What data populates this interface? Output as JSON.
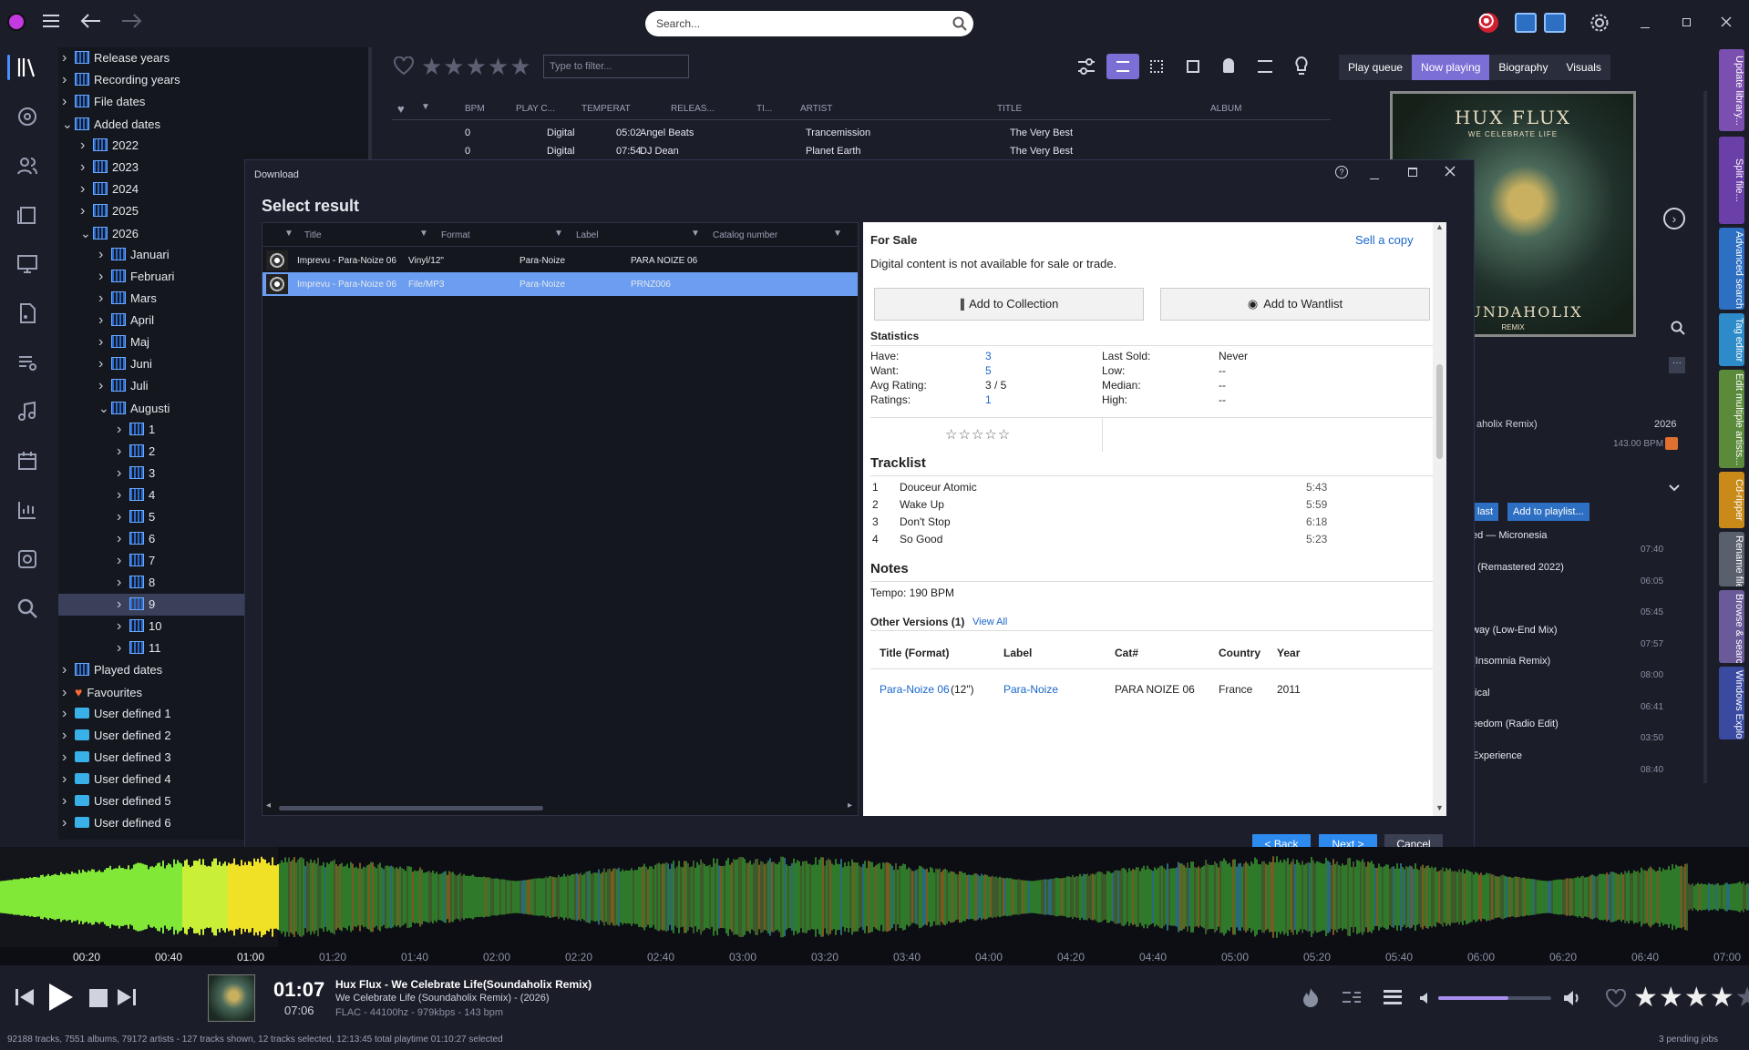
{
  "app": {
    "search_placeholder": "Search..."
  },
  "tree": {
    "items": [
      {
        "label": "Release years",
        "level": 0,
        "icon": "calendar",
        "open": false
      },
      {
        "label": "Recording years",
        "level": 0,
        "icon": "calendar",
        "open": false
      },
      {
        "label": "File dates",
        "level": 0,
        "icon": "calendar",
        "open": false
      },
      {
        "label": "Added dates",
        "level": 0,
        "icon": "calendar",
        "open": true
      },
      {
        "label": "2022",
        "level": 1,
        "icon": "calendar",
        "open": false
      },
      {
        "label": "2023",
        "level": 1,
        "icon": "calendar",
        "open": false
      },
      {
        "label": "2024",
        "level": 1,
        "icon": "calendar",
        "open": false
      },
      {
        "label": "2025",
        "level": 1,
        "icon": "calendar",
        "open": false
      },
      {
        "label": "2026",
        "level": 1,
        "icon": "calendar",
        "open": true
      },
      {
        "label": "Januari",
        "level": 2,
        "icon": "calendar",
        "open": false
      },
      {
        "label": "Februari",
        "level": 2,
        "icon": "calendar",
        "open": false
      },
      {
        "label": "Mars",
        "level": 2,
        "icon": "calendar",
        "open": false
      },
      {
        "label": "April",
        "level": 2,
        "icon": "calendar",
        "open": false
      },
      {
        "label": "Maj",
        "level": 2,
        "icon": "calendar",
        "open": false
      },
      {
        "label": "Juni",
        "level": 2,
        "icon": "calendar",
        "open": false
      },
      {
        "label": "Juli",
        "level": 2,
        "icon": "calendar",
        "open": false
      },
      {
        "label": "Augusti",
        "level": 2,
        "icon": "calendar",
        "open": true
      },
      {
        "label": "1",
        "level": 3,
        "icon": "calendar",
        "open": false
      },
      {
        "label": "2",
        "level": 3,
        "icon": "calendar",
        "open": false
      },
      {
        "label": "3",
        "level": 3,
        "icon": "calendar",
        "open": false
      },
      {
        "label": "4",
        "level": 3,
        "icon": "calendar",
        "open": false
      },
      {
        "label": "5",
        "level": 3,
        "icon": "calendar",
        "open": false
      },
      {
        "label": "6",
        "level": 3,
        "icon": "calendar",
        "open": false
      },
      {
        "label": "7",
        "level": 3,
        "icon": "calendar",
        "open": false
      },
      {
        "label": "8",
        "level": 3,
        "icon": "calendar",
        "open": false
      },
      {
        "label": "9",
        "level": 3,
        "icon": "calendar",
        "open": false,
        "selected": true
      },
      {
        "label": "10",
        "level": 3,
        "icon": "calendar",
        "open": false
      },
      {
        "label": "11",
        "level": 3,
        "icon": "calendar",
        "open": false
      },
      {
        "label": "Played dates",
        "level": 0,
        "icon": "calendar",
        "open": false
      },
      {
        "label": "Favourites",
        "level": 0,
        "icon": "heart",
        "open": false
      },
      {
        "label": "User defined 1",
        "level": 0,
        "icon": "folder",
        "open": false
      },
      {
        "label": "User defined 2",
        "level": 0,
        "icon": "folder",
        "open": false
      },
      {
        "label": "User defined 3",
        "level": 0,
        "icon": "folder",
        "open": false
      },
      {
        "label": "User defined 4",
        "level": 0,
        "icon": "folder",
        "open": false
      },
      {
        "label": "User defined 5",
        "level": 0,
        "icon": "folder",
        "open": false
      },
      {
        "label": "User defined 6",
        "level": 0,
        "icon": "folder",
        "open": false
      }
    ]
  },
  "main": {
    "filter_placeholder": "Type to filter...",
    "columns": [
      "BPM",
      "PLAY C...",
      "TEMPERAT",
      "RELEAS...",
      "TI...",
      "ARTIST",
      "TITLE",
      "ALBUM"
    ],
    "rows": [
      {
        "play": "0",
        "release": "Digital",
        "time": "05:02",
        "artist": "Angel Beats",
        "title": "Trancemission",
        "album": "The Very Best Of I"
      },
      {
        "play": "0",
        "release": "Digital",
        "time": "07:54",
        "artist": "DJ Dean",
        "title": "Planet Earth",
        "album": "The Very Best Of I"
      }
    ]
  },
  "right": {
    "tabs": [
      "Play queue",
      "Now playing",
      "Biography",
      "Visuals"
    ],
    "active_tab": "Now playing",
    "cover_title": "HUX FLUX",
    "cover_sub": "WE CELEBRATE LIFE",
    "cover_bottom": "SOUNDAHOLIX",
    "cover_remix": "REMIX",
    "info_title": "aholix Remix)",
    "info_year": "2026",
    "info_bpm": "143.00 BPM",
    "btn_last": "last",
    "btn_playlist": "Add to playlist...",
    "list": [
      {
        "title": "ed — Micronesia",
        "time": "07:40"
      },
      {
        "title": "t (Remastered 2022)",
        "time": "06:05"
      },
      {
        "title": "",
        "time": "05:45"
      },
      {
        "title": "way (Low-End Mix)",
        "time": "07:57"
      },
      {
        "title": "(Insomnia Remix)",
        "time": "08:00"
      },
      {
        "title": "tical",
        "time": "06:41"
      },
      {
        "title": "eedom (Radio Edit)",
        "time": "03:50"
      },
      {
        "title": "Experience",
        "time": "08:40"
      }
    ]
  },
  "vtabs": [
    {
      "label": "Update library...",
      "color": "#7b4fb0"
    },
    {
      "label": "Split file...",
      "color": "#6b3fa8"
    },
    {
      "label": "Advanced search",
      "color": "#2d6fc2"
    },
    {
      "label": "Tag editor",
      "color": "#2d8bc9"
    },
    {
      "label": "Edit multiple artists...",
      "color": "#5a8a3a"
    },
    {
      "label": "Cd-ripper",
      "color": "#c98a1a"
    },
    {
      "label": "Rename files",
      "color": "#5a5f6e"
    },
    {
      "label": "Browse & search",
      "color": "#6a5a9a"
    },
    {
      "label": "Windows Explorer",
      "color": "#3a4aa0"
    }
  ],
  "dialog": {
    "title": "Download",
    "heading": "Select result",
    "grid_cols": [
      "Title",
      "Format",
      "Label",
      "Catalog number"
    ],
    "results": [
      {
        "title": "Imprevu - Para-Noize 06",
        "format": "Vinyl/12\"",
        "label": "Para-Noize",
        "catalog": "PARA NOIZE 06"
      },
      {
        "title": "Imprevu - Para-Noize 06",
        "format": "File/MP3",
        "label": "Para-Noize",
        "catalog": "PRNZ006"
      }
    ],
    "selected_index": 1,
    "for_sale": "For Sale",
    "sell": "Sell a copy",
    "digital_note": "Digital content is not available for sale or trade.",
    "add_collection": "Add to Collection",
    "add_wantlist": "Add to Wantlist",
    "statistics": "Statistics",
    "stats_left": [
      {
        "k": "Have:",
        "v": "3",
        "link": true
      },
      {
        "k": "Want:",
        "v": "5",
        "link": true
      },
      {
        "k": "Avg Rating:",
        "v": "3 / 5",
        "link": false
      },
      {
        "k": "Ratings:",
        "v": "1",
        "link": true
      }
    ],
    "stats_right": [
      {
        "k": "Last Sold:",
        "v": "Never"
      },
      {
        "k": "Low:",
        "v": "--"
      },
      {
        "k": "Median:",
        "v": "--"
      },
      {
        "k": "High:",
        "v": "--"
      }
    ],
    "tracklist": "Tracklist",
    "tracks": [
      {
        "n": "1",
        "t": "Douceur Atomic",
        "d": "5:43"
      },
      {
        "n": "2",
        "t": "Wake Up",
        "d": "5:59"
      },
      {
        "n": "3",
        "t": "Don't Stop",
        "d": "6:18"
      },
      {
        "n": "4",
        "t": "So Good",
        "d": "5:23"
      }
    ],
    "notes": "Notes",
    "tempo": "Tempo: 190 BPM",
    "other_versions": "Other Versions (1)",
    "view_all": "View All",
    "ov_cols": [
      "Title (Format)",
      "Label",
      "Cat#",
      "Country",
      "Year"
    ],
    "ov_row": {
      "title": "Para-Noize 06",
      "format": "(12\")",
      "label": "Para-Noize",
      "cat": "PARA NOIZE 06",
      "country": "France",
      "year": "2011"
    },
    "back": "< Back",
    "next": "Next >",
    "cancel": "Cancel"
  },
  "timeline": [
    "00:20",
    "00:40",
    "01:00",
    "01:20",
    "01:40",
    "02:00",
    "02:20",
    "02:40",
    "03:00",
    "03:20",
    "03:40",
    "04:00",
    "04:20",
    "04:40",
    "05:00",
    "05:20",
    "05:40",
    "06:00",
    "06:20",
    "06:40",
    "07:00"
  ],
  "player": {
    "elapsed": "01:07",
    "total": "07:06",
    "track": "Hux Flux - We Celebrate Life(Soundaholix Remix)",
    "album": "We Celebrate Life (Soundaholix Remix) - (2026)",
    "format": "FLAC - 44100hz - 979kbps - 143 bpm",
    "volume": 0.62,
    "rating": 4
  },
  "status": {
    "left": "92188 tracks, 7551 albums, 79172 artists - 127 tracks shown, 12 tracks selected, 12:13:45 total playtime 01:10:27 selected",
    "right": "3 pending jobs"
  }
}
